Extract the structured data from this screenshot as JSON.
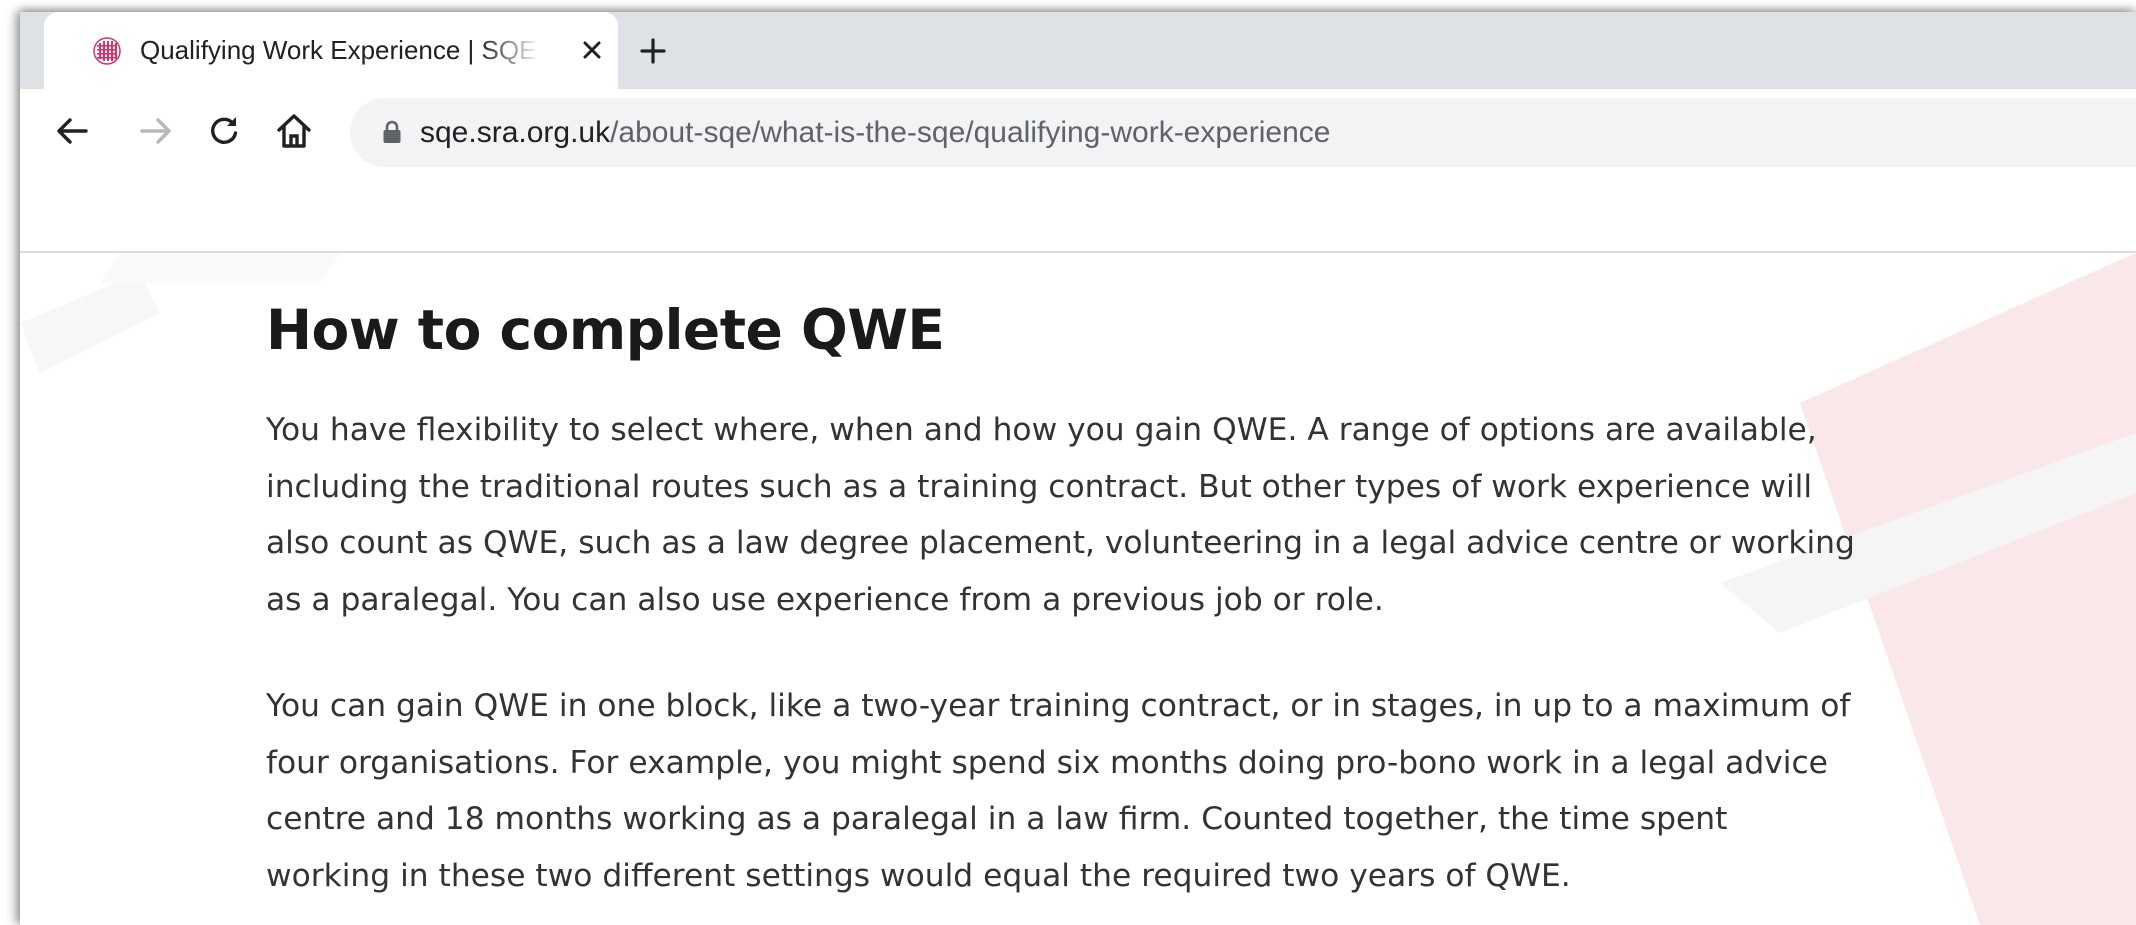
{
  "browser": {
    "tab": {
      "title": "Qualifying Work Experience | SQE",
      "favicon": "sra-logo-icon"
    },
    "new_tab_label": "+",
    "url_host": "sqe.sra.org.uk",
    "url_path": "/about-sqe/what-is-the-sqe/qualifying-work-experience",
    "icons": {
      "back": "arrow-left-icon",
      "forward": "arrow-right-icon",
      "reload": "reload-icon",
      "home": "home-icon",
      "lock": "lock-icon",
      "close": "close-icon",
      "new_tab": "plus-icon"
    }
  },
  "page": {
    "heading": "How to complete QWE",
    "paragraphs": [
      {
        "lines": [
          "You have flexibility to select where, when and how you gain QWE. A range of options are available,",
          "including the traditional routes such as a training contract. But other types of work experience will",
          "also count as QWE, such as a law degree placement, volunteering in a legal advice centre or working",
          "as a paralegal. You can also use experience from a previous job or role."
        ]
      },
      {
        "lines": [
          "You can gain QWE in one block, like a two-year training contract, or in stages, in up to a maximum of",
          "four organisations. For example, you might spend six months doing pro-bono work in a legal advice",
          "centre and 18 months working as a paralegal in a law firm. Counted together, the time spent",
          "working in these two different settings would equal the required two years of QWE."
        ]
      }
    ]
  },
  "colors": {
    "tabstrip_bg": "#dee1e6",
    "omnibox_bg": "#f1f3f4",
    "heading_text": "#1a1a1a",
    "body_text": "#333333",
    "favicon_accent": "#d6336c",
    "deco_red": "#f7e4e7"
  }
}
